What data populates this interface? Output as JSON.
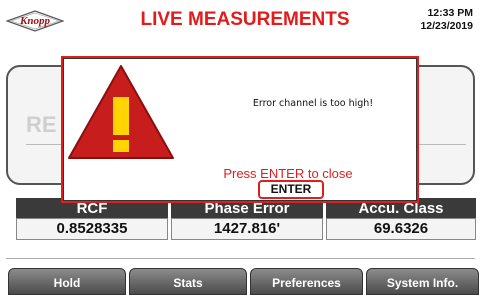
{
  "header": {
    "logo_text": "Knopp",
    "title": "LIVE MEASUREMENTS",
    "time": "12:33 PM",
    "date": "12/23/2019"
  },
  "background": {
    "partial_label": "RE"
  },
  "measurements": [
    {
      "label": "RCF",
      "value": "0.8528335"
    },
    {
      "label": "Phase Error",
      "value": "1427.816'"
    },
    {
      "label": "Accu. Class",
      "value": "69.6326"
    }
  ],
  "nav": [
    "Hold",
    "Stats",
    "Preferences",
    "System Info."
  ],
  "dialog": {
    "message": "Error channel is too high!",
    "prompt": "Press ENTER to close",
    "button_label": "ENTER",
    "icon": "warning-icon"
  },
  "colors": {
    "accent_red": "#e31b1b",
    "warning_red": "#c81d1d",
    "warning_yellow": "#ffd400",
    "nav_dark": "#4a4a4a"
  }
}
